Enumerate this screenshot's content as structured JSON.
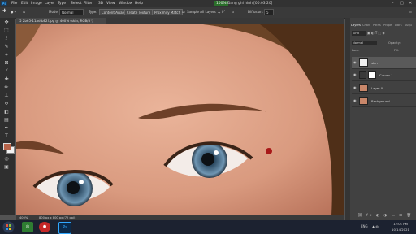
{
  "app": {
    "logo": "Ps",
    "menu": [
      "File",
      "Edit",
      "Image",
      "Layer",
      "Type",
      "Select",
      "Filter",
      "3D",
      "View",
      "Window",
      "Help"
    ],
    "zoom_indicator": "100%",
    "title_center": "Đang ghi hình [00:03:20]"
  },
  "options": {
    "mode_label": "Mode:",
    "mode_value": "Normal",
    "type_label": "Type:",
    "content_aware": "Content-Aware",
    "create_texture": "Create Texture",
    "proximity_match": "Proximity Match",
    "sample_all_layers": "Sample All Layers",
    "diffusion_label": "Diffusion:",
    "diffusion_value": "5"
  },
  "document": {
    "tab_title": "5 2b65-11ad-b82f.jpg @ 400% (skin, RGB/8*)",
    "zoom": "400%",
    "doc_info": "800 px x 800 px (72 ppi)"
  },
  "panels": {
    "tabs": [
      "Layers",
      "Chan",
      "Paths",
      "Prope",
      "Librs",
      "Adju"
    ],
    "kind_filter": "Kind",
    "blend_mode": "Normal",
    "opacity_label": "Opacity:",
    "fill_label": "Fill:",
    "lock_label": "Lock:",
    "layers": [
      {
        "name": "skin",
        "thumb": "#f0f0f0",
        "visible": true,
        "selected": true
      },
      {
        "name": "Curves 1",
        "thumb": "#ffffff",
        "visible": true,
        "selected": false
      },
      {
        "name": "Layer 0",
        "thumb": "#c9876a",
        "visible": true,
        "selected": false
      },
      {
        "name": "Background",
        "thumb": "#c9876a",
        "visible": true,
        "selected": false
      }
    ]
  },
  "taskbar": {
    "ps_label": "Ps",
    "lang": "ENG",
    "time": "12:01 PM",
    "date": "10/14/2021"
  },
  "colors": {
    "foreground": "#b7644a",
    "background": "#f2f2f2",
    "accent": "#31a8ff"
  }
}
